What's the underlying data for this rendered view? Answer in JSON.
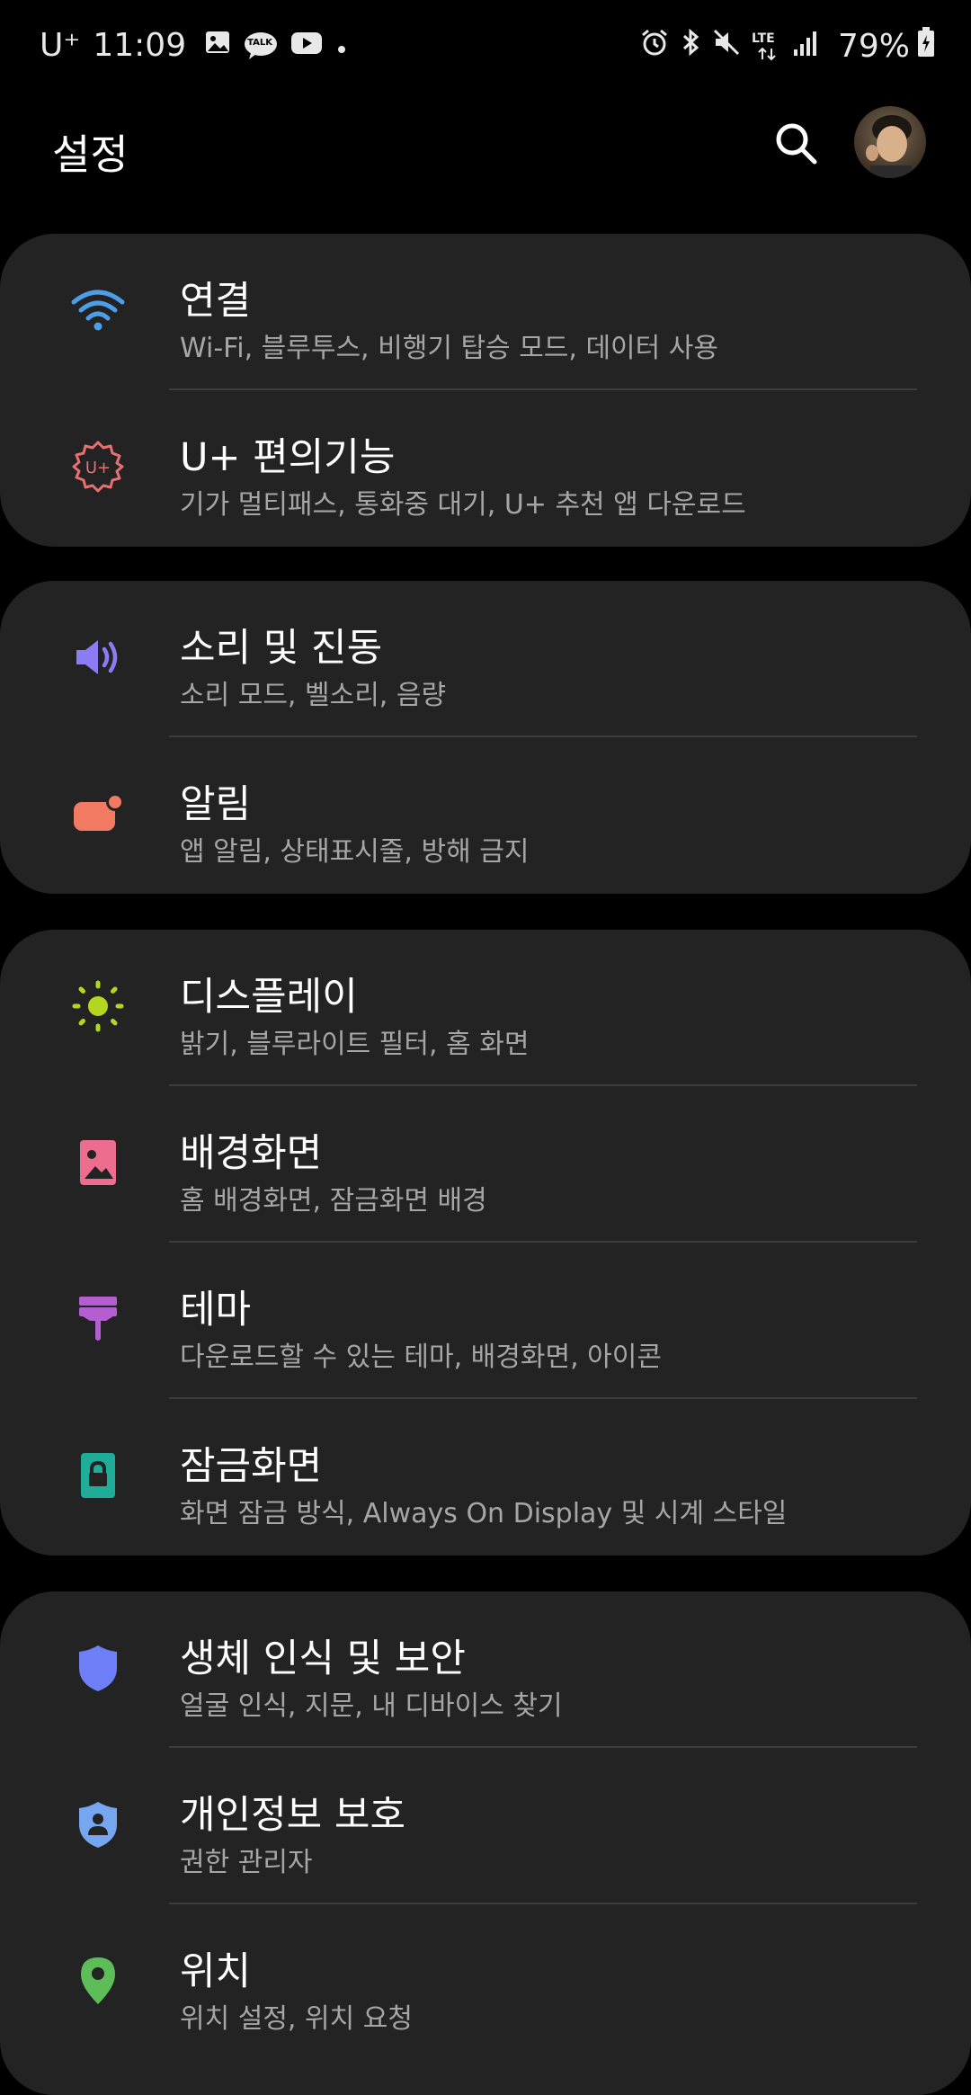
{
  "status_bar": {
    "carrier": "U⁺",
    "time": "11:09",
    "left_icons": [
      "image-icon",
      "kakaotalk-icon",
      "youtube-icon",
      "dot-icon"
    ],
    "kakaotalk_label": "TALK",
    "right_icons": [
      "alarm-icon",
      "bluetooth-icon",
      "mute-icon",
      "lte-icon",
      "signal-icon",
      "battery-icon"
    ],
    "network": "LTE",
    "battery": "79%"
  },
  "header": {
    "title": "설정"
  },
  "colors": {
    "background": "#000000",
    "card": "#232323",
    "divider": "#3d3d3d",
    "subtitle": "#a6a6a6",
    "wifi_icon": "#4c9ee8",
    "u_plus_icon": "#e87070",
    "sound_icon": "#8b7cf3",
    "notification_icon": "#f27a62",
    "display_icon": "#b5d621",
    "wallpaper_icon": "#ec6d8e",
    "theme_icon": "#b45ed1",
    "lockscreen_icon": "#1fad9a",
    "biometric_icon": "#6f7ff7",
    "privacy_icon": "#76a6f0",
    "location_icon": "#5cbd59"
  },
  "groups": [
    {
      "items": [
        {
          "name": "connections",
          "icon": "wifi-icon",
          "title": "연결",
          "subtitle": "Wi-Fi, 블루투스, 비행기 탑승 모드, 데이터 사용"
        },
        {
          "name": "u-plus-features",
          "icon": "u-plus-gear-icon",
          "title": "U+ 편의기능",
          "subtitle": "기가 멀티패스, 통화중 대기, U+ 추천 앱 다운로드"
        }
      ]
    },
    {
      "items": [
        {
          "name": "sound",
          "icon": "speaker-icon",
          "title": "소리 및 진동",
          "subtitle": "소리 모드, 벨소리, 음량"
        },
        {
          "name": "notifications",
          "icon": "notification-icon",
          "title": "알림",
          "subtitle": "앱 알림, 상태표시줄, 방해 금지"
        }
      ]
    },
    {
      "items": [
        {
          "name": "display",
          "icon": "sun-icon",
          "title": "디스플레이",
          "subtitle": "밝기, 블루라이트 필터, 홈 화면"
        },
        {
          "name": "wallpaper",
          "icon": "wallpaper-icon",
          "title": "배경화면",
          "subtitle": "홈 배경화면, 잠금화면 배경"
        },
        {
          "name": "themes",
          "icon": "paint-brush-icon",
          "title": "테마",
          "subtitle": "다운로드할 수 있는 테마, 배경화면, 아이콘"
        },
        {
          "name": "lock-screen",
          "icon": "lock-icon",
          "title": "잠금화면",
          "subtitle": "화면 잠금 방식, Always On Display 및 시계 스타일"
        }
      ]
    },
    {
      "items": [
        {
          "name": "biometrics-security",
          "icon": "shield-icon",
          "title": "생체 인식 및 보안",
          "subtitle": "얼굴 인식, 지문, 내 디바이스 찾기"
        },
        {
          "name": "privacy",
          "icon": "privacy-shield-icon",
          "title": "개인정보 보호",
          "subtitle": "권한 관리자"
        },
        {
          "name": "location",
          "icon": "location-pin-icon",
          "title": "위치",
          "subtitle": "위치 설정, 위치 요청"
        }
      ]
    }
  ]
}
